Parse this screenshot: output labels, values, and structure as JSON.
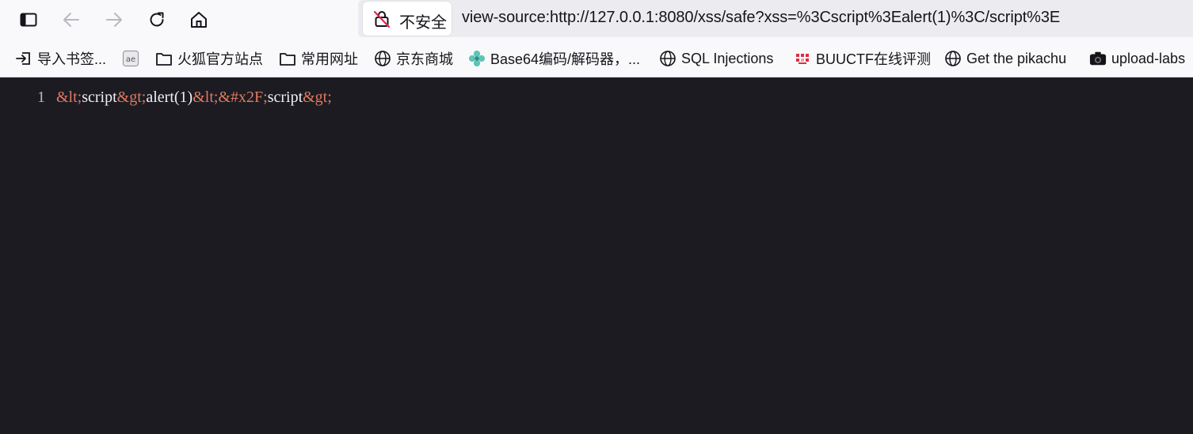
{
  "toolbar": {
    "sidebar_icon": "sidebar-icon",
    "back_icon": "back-arrow-icon",
    "forward_icon": "forward-arrow-icon",
    "reload_icon": "reload-icon",
    "home_icon": "home-icon"
  },
  "urlbar": {
    "security_label": "不安全",
    "security_icon": "insecure-lock-icon",
    "url": "view-source:http://127.0.0.1:8080/xss/safe?xss=%3Cscript%3Ealert(1)%3C/script%3E"
  },
  "bookmarks": [
    {
      "label": "导入书签...",
      "icon": "import-icon"
    },
    {
      "label": "",
      "icon": "ae-icon"
    },
    {
      "label": "火狐官方站点",
      "icon": "folder-icon"
    },
    {
      "label": "常用网址",
      "icon": "folder-icon"
    },
    {
      "label": "京东商城",
      "icon": "globe-icon"
    },
    {
      "label": "Base64编码/解码器，...",
      "icon": "flower-icon"
    },
    {
      "label": "SQL Injections",
      "icon": "globe-icon"
    },
    {
      "label": "BUUCTF在线评测",
      "icon": "buuctf-icon"
    },
    {
      "label": "Get the pikachu",
      "icon": "globe-icon"
    },
    {
      "label": "upload-labs",
      "icon": "camera-icon"
    }
  ],
  "source": {
    "line_number": "1",
    "tokens": [
      {
        "text": "&lt;",
        "kind": "entity"
      },
      {
        "text": "script",
        "kind": "text"
      },
      {
        "text": "&gt;",
        "kind": "entity"
      },
      {
        "text": "alert(1)",
        "kind": "text"
      },
      {
        "text": "&lt;",
        "kind": "entity"
      },
      {
        "text": "&#x2F;",
        "kind": "entity"
      },
      {
        "text": "script",
        "kind": "text"
      },
      {
        "text": "&gt;",
        "kind": "entity"
      }
    ]
  },
  "colors": {
    "page_background": "#1c1b22",
    "entity": "#e07a5f",
    "text": "#f0f0f4",
    "line_number": "#b9b9c2"
  }
}
